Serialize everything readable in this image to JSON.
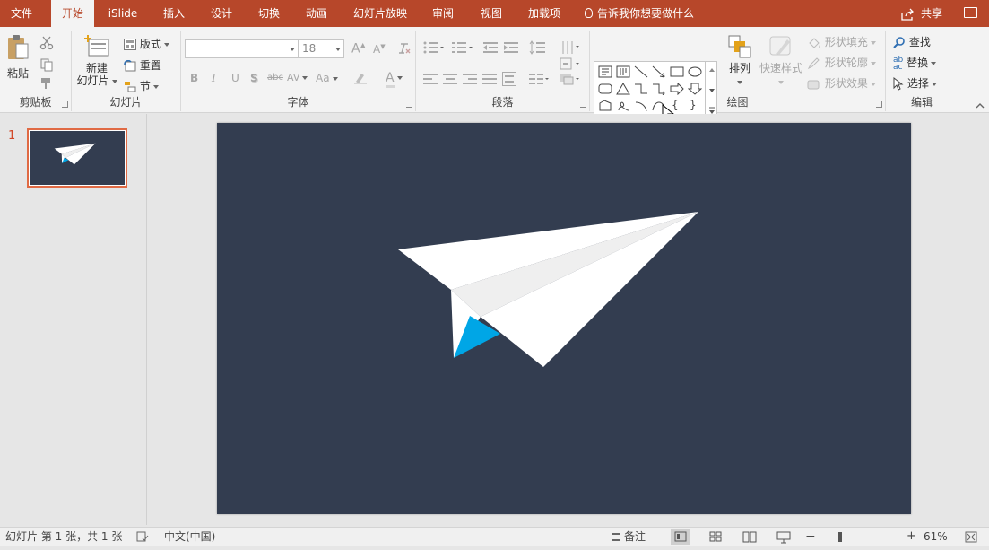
{
  "tabs": [
    {
      "label": "文件",
      "active": false
    },
    {
      "label": "开始",
      "active": true
    },
    {
      "label": "iSlide",
      "active": false
    },
    {
      "label": "插入",
      "active": false
    },
    {
      "label": "设计",
      "active": false
    },
    {
      "label": "切换",
      "active": false
    },
    {
      "label": "动画",
      "active": false
    },
    {
      "label": "幻灯片放映",
      "active": false
    },
    {
      "label": "审阅",
      "active": false
    },
    {
      "label": "视图",
      "active": false
    },
    {
      "label": "加载项",
      "active": false
    }
  ],
  "tellme": "告诉我你想要做什么",
  "share": "共享",
  "clipboard": {
    "paste": "粘贴",
    "label": "剪贴板"
  },
  "slides_group": {
    "new_line1": "新建",
    "new_line2": "幻灯片",
    "layout": "版式",
    "reset": "重置",
    "section": "节",
    "label": "幻灯片"
  },
  "font": {
    "name_value": "",
    "size_value": "18",
    "bold": "B",
    "italic": "I",
    "underline": "U",
    "shadow": "S",
    "strike": "abc",
    "spacing": "AV",
    "case": "Aa",
    "color": "A",
    "grow": "A",
    "shrink": "A",
    "label": "字体"
  },
  "paragraph": {
    "label": "段落"
  },
  "drawing": {
    "arrange": "排列",
    "quick_styles": "快速样式",
    "fill": "形状填充",
    "outline": "形状轮廓",
    "effects": "形状效果",
    "label": "绘图"
  },
  "editing": {
    "find": "查找",
    "replace": "替换",
    "select": "选择",
    "label": "编辑"
  },
  "thumbnails": [
    {
      "number": "1"
    }
  ],
  "status": {
    "slide_info": "幻灯片 第 1 张，共 1 张",
    "language": "中文(中国)",
    "notes": "备注",
    "zoom": "61%"
  },
  "colors": {
    "accent": "#b7472a",
    "slide_bg": "#333d50",
    "plane_white": "#ffffff",
    "plane_shade": "#efefef",
    "plane_blue": "#00a6e6"
  }
}
